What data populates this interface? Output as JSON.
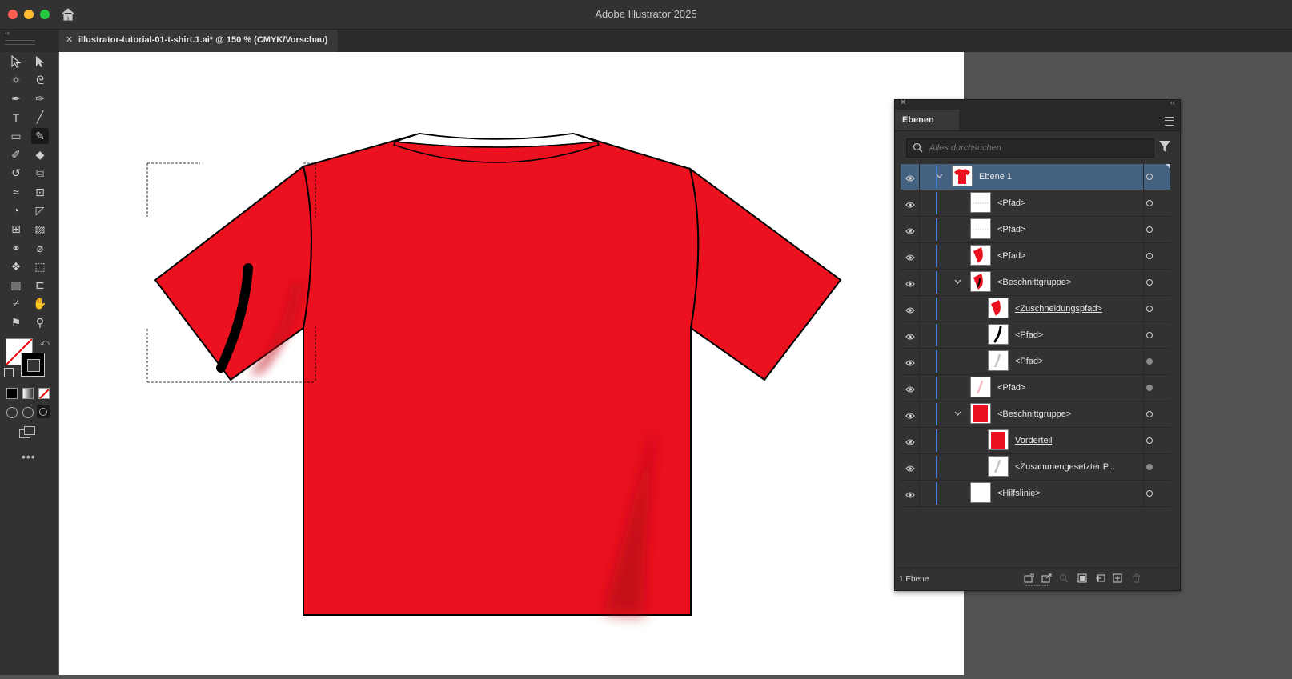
{
  "app": {
    "title": "Adobe Illustrator 2025"
  },
  "document": {
    "tab_label": "illustrator-tutorial-01-t-shirt.1.ai* @ 150 % (CMYK/Vorschau)"
  },
  "colors": {
    "shirt": "#ec111f",
    "shirt_shadow": "#c40d1a",
    "stripe": "#000000",
    "selection": "#44627f",
    "layer_color": "#3f7bd9"
  },
  "toolbar": {
    "tools": [
      {
        "name": "selection-tool-icon"
      },
      {
        "name": "direct-selection-tool-icon"
      },
      {
        "name": "magic-wand-tool-icon"
      },
      {
        "name": "lasso-tool-icon"
      },
      {
        "name": "pen-tool-icon"
      },
      {
        "name": "curvature-tool-icon"
      },
      {
        "name": "type-tool-icon"
      },
      {
        "name": "line-segment-tool-icon"
      },
      {
        "name": "rectangle-tool-icon"
      },
      {
        "name": "shaper-tool-icon"
      },
      {
        "name": "paintbrush-tool-icon"
      },
      {
        "name": "eraser-tool-icon"
      },
      {
        "name": "rotate-tool-icon"
      },
      {
        "name": "scale-tool-icon"
      },
      {
        "name": "width-tool-icon"
      },
      {
        "name": "free-transform-tool-icon"
      },
      {
        "name": "shape-builder-tool-icon"
      },
      {
        "name": "perspective-grid-tool-icon"
      },
      {
        "name": "mesh-tool-icon"
      },
      {
        "name": "gradient-tool-icon"
      },
      {
        "name": "blend-tool-icon"
      },
      {
        "name": "eyedropper-tool-icon"
      },
      {
        "name": "symbol-sprayer-tool-icon"
      },
      {
        "name": "live-paint-tool-icon"
      },
      {
        "name": "column-graph-tool-icon"
      },
      {
        "name": "artboard-tool-icon"
      },
      {
        "name": "slice-tool-icon"
      },
      {
        "name": "hand-tool-icon"
      },
      {
        "name": "puppet-warp-tool-icon"
      },
      {
        "name": "zoom-tool-icon"
      }
    ]
  },
  "layers_panel": {
    "tab_label": "Ebenen",
    "search_placeholder": "Alles durchsuchen",
    "footer_count": "1 Ebene",
    "rows": [
      {
        "label": "Ebene 1",
        "expanded": true,
        "selected": true,
        "thumb": "shirt",
        "target_filled": false
      },
      {
        "label": "<Pfad>",
        "thumb": "line",
        "target_filled": false
      },
      {
        "label": "<Pfad>",
        "thumb": "line",
        "target_filled": false
      },
      {
        "label": "<Pfad>",
        "thumb": "sleeve",
        "target_filled": false
      },
      {
        "label": "<Beschnittgruppe>",
        "expanded": true,
        "thumb": "sleeve-stripe",
        "target_filled": false
      },
      {
        "label": "<Zuschneidungspfad>",
        "underline": true,
        "thumb": "sleeve",
        "target_filled": false
      },
      {
        "label": "<Pfad>",
        "thumb": "stripe",
        "target_filled": false
      },
      {
        "label": "<Pfad>",
        "thumb": "shadow",
        "target_filled": true
      },
      {
        "label": "<Pfad>",
        "thumb": "shadow-red",
        "target_filled": true
      },
      {
        "label": "<Beschnittgruppe>",
        "expanded": true,
        "thumb": "body",
        "target_filled": false
      },
      {
        "label": "Vorderteil",
        "underline": true,
        "thumb": "body",
        "target_filled": false
      },
      {
        "label": "<Zusammengesetzter P...",
        "thumb": "shadow",
        "target_filled": true
      },
      {
        "label": "<Hilfslinie>",
        "thumb": "blank",
        "target_filled": false
      }
    ]
  }
}
